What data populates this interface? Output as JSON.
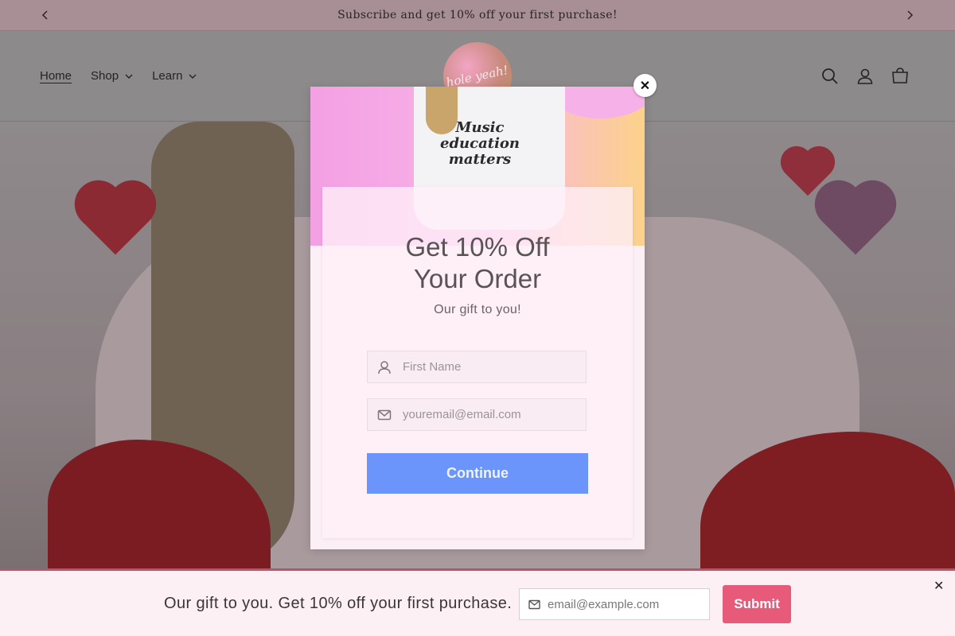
{
  "announcement": {
    "text": "Subscribe and get 10% off your first purchase!",
    "prev_icon": "chevron-left-icon",
    "next_icon": "chevron-right-icon"
  },
  "header": {
    "logo_text": "hole yeah!",
    "nav": [
      {
        "label": "Home",
        "active": true
      },
      {
        "label": "Shop",
        "has_dropdown": true
      },
      {
        "label": "Learn",
        "has_dropdown": true
      }
    ],
    "icons": [
      "search-icon",
      "account-icon",
      "cart-icon"
    ]
  },
  "popup": {
    "shirt_print": "Music education matters",
    "title_line1": "Get 10% Off",
    "title_line2": "Your Order",
    "subtitle": "Our gift to you!",
    "first_name_placeholder": "First Name",
    "email_placeholder": "youremail@email.com",
    "continue_label": "Continue",
    "close_symbol": "✕",
    "accent": "#6b95fb"
  },
  "bottom_bar": {
    "text": "Our gift to you. Get 10% off your first purchase.",
    "email_placeholder": "email@example.com",
    "submit_label": "Submit",
    "close_symbol": "✕",
    "accent": "#e75a79"
  }
}
